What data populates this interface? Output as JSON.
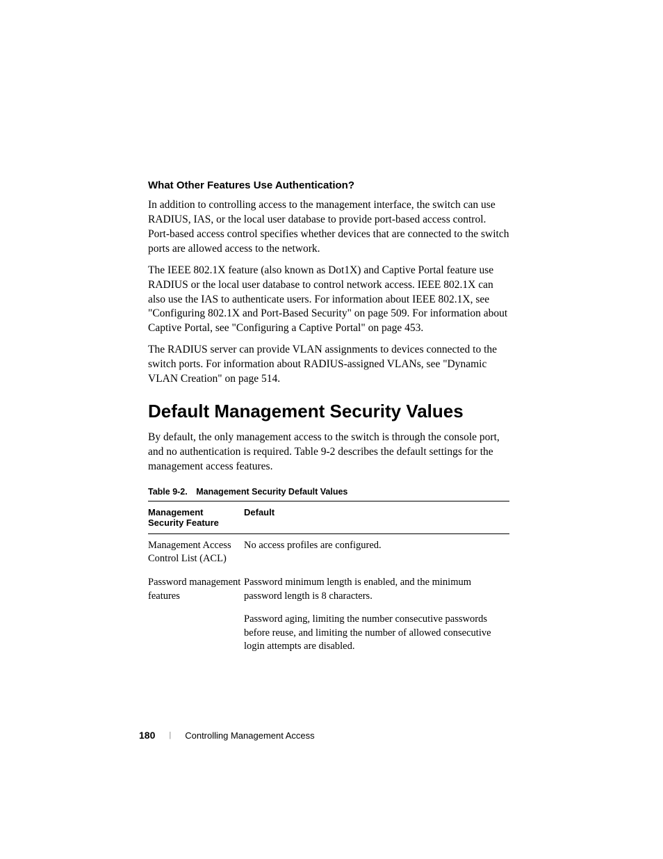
{
  "subsection_heading": "What Other Features Use Authentication?",
  "paragraph1": "In addition to controlling access to the management interface, the switch can use RADIUS, IAS, or the local user database to provide port-based access control. Port-based access control specifies whether devices that are connected to the switch ports are allowed access to the network.",
  "paragraph2": "The IEEE 802.1X feature (also known as Dot1X) and Captive Portal feature use RADIUS or the local user database to control network access. IEEE 802.1X can also use the IAS to authenticate users. For information about IEEE 802.1X, see \"Configuring 802.1X and Port-Based Security\" on page 509. For information about Captive Portal, see \"Configuring a Captive Portal\" on page 453.",
  "paragraph3": "The RADIUS server can provide VLAN assignments to devices connected to the switch ports. For information about RADIUS-assigned VLANs, see \"Dynamic VLAN Creation\" on page 514.",
  "section_heading": "Default Management Security Values",
  "paragraph4": "By default, the only management access to the switch is through the console port, and no authentication is required. Table 9-2 describes the default settings for the management access features.",
  "table": {
    "caption": "Table 9-2. Management Security Default Values",
    "headers": [
      "Management Security Feature",
      "Default"
    ],
    "rows": [
      {
        "feature": "Management Access Control List (ACL)",
        "default": "No access profiles are configured."
      },
      {
        "feature": "Password management features",
        "default": "Password minimum length is enabled, and the minimum password length is 8 characters."
      },
      {
        "feature": "",
        "default": "Password aging, limiting the number consecutive passwords before reuse, and limiting the number of allowed consecutive login attempts are disabled."
      }
    ]
  },
  "footer": {
    "page_number": "180",
    "section_title": "Controlling Management Access"
  }
}
